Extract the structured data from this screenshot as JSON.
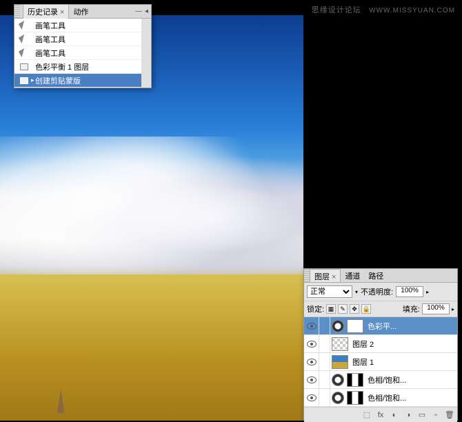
{
  "watermark": {
    "title": "思缘设计论坛",
    "url": "WWW.MISSYUAN.COM"
  },
  "history_panel": {
    "tabs": {
      "history": "历史记录",
      "actions": "动作"
    },
    "items": [
      {
        "label": "画笔工具",
        "type": "brush"
      },
      {
        "label": "画笔工具",
        "type": "brush"
      },
      {
        "label": "画笔工具",
        "type": "brush"
      },
      {
        "label": "色彩平衡 1 图层",
        "type": "layer"
      },
      {
        "label": "创建剪贴蒙版",
        "type": "layer",
        "selected": true
      }
    ]
  },
  "layers_panel": {
    "tabs": {
      "layers": "图层",
      "channels": "通道",
      "paths": "路径"
    },
    "blend_mode": "正常",
    "opacity_label": "不透明度:",
    "opacity_value": "100%",
    "lock_label": "锁定:",
    "fill_label": "填充:",
    "fill_value": "100%",
    "layers": [
      {
        "name": "色彩平...",
        "type": "adj",
        "selected": true
      },
      {
        "name": "图层 2",
        "type": "checker"
      },
      {
        "name": "图层 1",
        "type": "img"
      },
      {
        "name": "色相/饱和...",
        "type": "adj2"
      },
      {
        "name": "色相/饱和...",
        "type": "adj2"
      }
    ]
  }
}
